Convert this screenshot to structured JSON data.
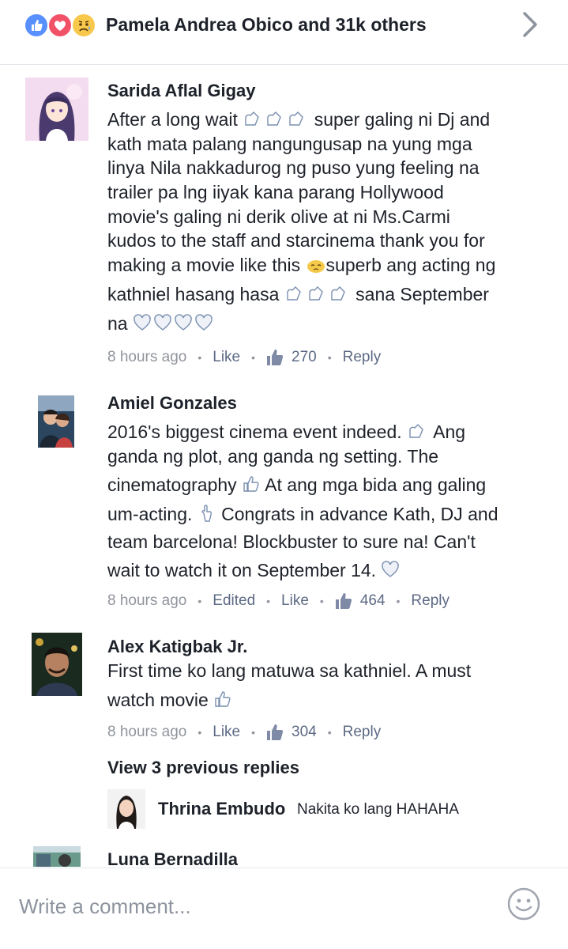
{
  "header": {
    "reactions": [
      "like-icon",
      "love-icon",
      "sad-icon"
    ],
    "title": "Pamela Andrea Obico and 31k others",
    "chevron": "chevron-right-icon"
  },
  "comments": [
    {
      "name": "Sarida Aflal Gigay",
      "lines": [
        "After a long wait ",
        "kath mata palang nangungusap na yung mga",
        "linya Nila nakkadurog ng puso yung feeling na",
        "trailer pa lng iiyak kana parang Hollywood",
        "movie's galing ni derik olive at ni Ms.Carmi",
        "kudos to the staff and starcinema thank you for",
        "making a movie like this ",
        "kathniel hasang hasa ",
        "na "
      ],
      "line1_tail": " super galing ni Dj and",
      "line7_tail": "superb ang acting ng",
      "line8_tail": " sana September",
      "time": "8 hours ago",
      "like": "Like",
      "count": "270",
      "reply": "Reply"
    },
    {
      "name": "Amiel Gonzales",
      "lines": [
        "2016's biggest cinema event indeed. ",
        "ganda ng plot, ang ganda ng setting. The",
        "cinematography ",
        "um-acting. ",
        "team barcelona! Blockbuster to sure na! Can't",
        "wait to watch it on September 14. "
      ],
      "line1_tail": " Ang",
      "line3_tail": " At ang mga bida ang galing",
      "line4_tail": " Congrats in advance Kath, DJ and",
      "time": "8 hours ago",
      "edited": "Edited",
      "like": "Like",
      "count": "464",
      "reply": "Reply"
    },
    {
      "name": "Alex Katigbak Jr.",
      "lines": [
        "First time ko lang matuwa sa kathniel. A must",
        "watch movie "
      ],
      "time": "8 hours ago",
      "like": "Like",
      "count": "304",
      "reply": "Reply"
    }
  ],
  "view_previous": "View 3 previous replies",
  "reply": {
    "name": "Thrina Embudo",
    "text": "Nakita ko lang HAHAHA"
  },
  "next_comment_name": "Luna Bernadilla",
  "composer": {
    "placeholder": "Write a comment...",
    "emoji_icon": "smiley-icon"
  },
  "colors": {
    "like_blue": "#5890ff",
    "love_red": "#f25268",
    "meta_gray": "#90949c",
    "link_blue": "#5d6a85"
  }
}
